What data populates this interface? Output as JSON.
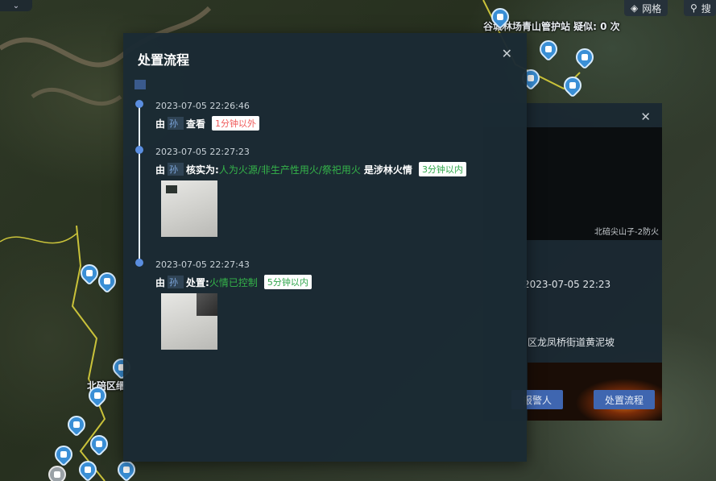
{
  "map": {
    "label_top": "谷城林场青山管护站 疑似: 0 次",
    "label_left": "北碚区缙",
    "layer_button": "网格",
    "search_button": "搜",
    "bg_label_1": "北碚尖山子-2防火",
    "colors": {
      "pin": "#3a8fd6",
      "boundary": "#c9c23a"
    }
  },
  "detail_panel": {
    "video_label": "北碚尖山子-2防火",
    "time": "2023-07-05 22:23",
    "address": "区龙凤桥街道黄泥坡",
    "btn_alarm": "报警人",
    "btn_flow": "处置流程"
  },
  "modal": {
    "title": "处置流程",
    "entries": [
      {
        "time": "2023-07-05 22:26:46",
        "prefix": "由",
        "person": "孙",
        "action": "查看",
        "detail": "",
        "suffix": "",
        "badge": "1分钟以外",
        "badge_color": "red"
      },
      {
        "time": "2023-07-05 22:27:23",
        "prefix": "由",
        "person": "孙",
        "action": "核实为:",
        "detail": "人为火源/非生产性用火/祭祀用火",
        "suffix": "是涉林火情",
        "badge": "3分钟以内",
        "badge_color": "green"
      },
      {
        "time": "2023-07-05 22:27:43",
        "prefix": "由",
        "person": "孙",
        "action": "处置:",
        "detail": "火情已控制",
        "suffix": "",
        "badge": "5分钟以内",
        "badge_color": "green"
      }
    ]
  }
}
